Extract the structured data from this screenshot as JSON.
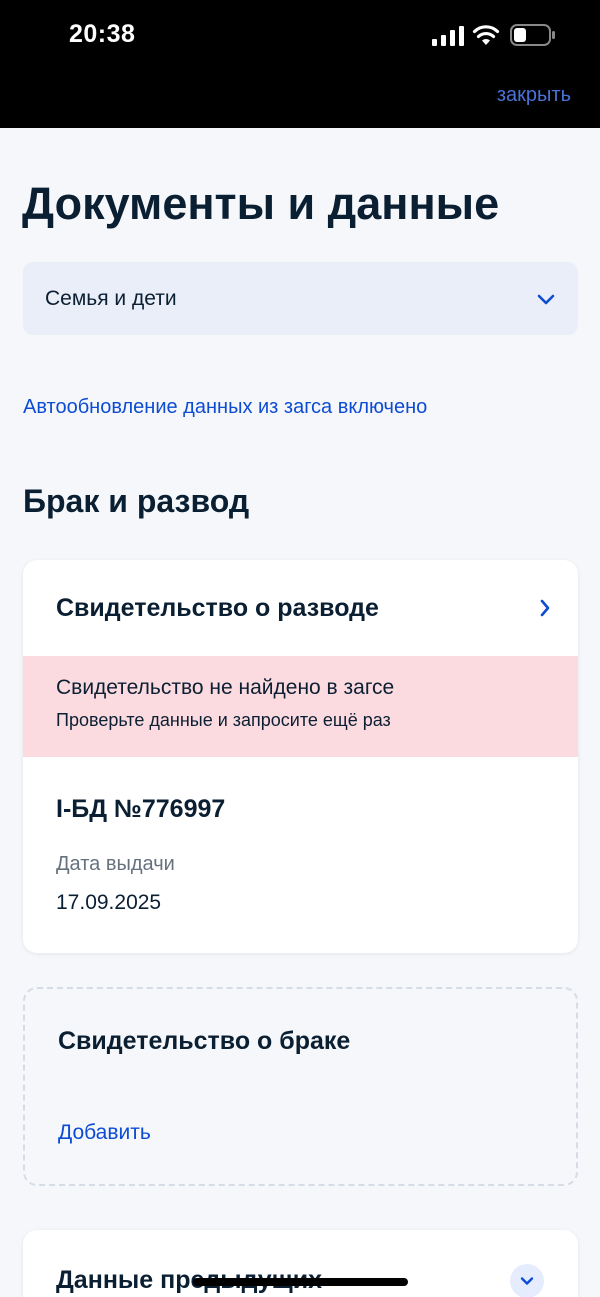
{
  "status_bar": {
    "time": "20:38"
  },
  "header": {
    "close_label": "закрыть"
  },
  "page": {
    "title": "Документы и данные",
    "category_select": {
      "value": "Семья и дети",
      "icon": "chevron-down-icon"
    },
    "autoupdate_text": "Автообновление данных из загса включено",
    "section_title": "Брак и развод"
  },
  "divorce_card": {
    "title": "Свидетельство о разводе",
    "alert": {
      "title": "Свидетельство не найдено в загсе",
      "subtitle": "Проверьте данные и запросите ещё раз",
      "color": "#fbdbe0"
    },
    "number": "I-БД №776997",
    "issue_label": "Дата выдачи",
    "issue_date": "17.09.2025"
  },
  "marriage_card": {
    "title": "Свидетельство о браке",
    "add_label": "Добавить"
  },
  "previous_card": {
    "title": "Данные предыдущих"
  },
  "colors": {
    "accent": "#0d4cd3",
    "text": "#0b1f33",
    "muted": "#66727f",
    "background": "#f5f7fa"
  }
}
